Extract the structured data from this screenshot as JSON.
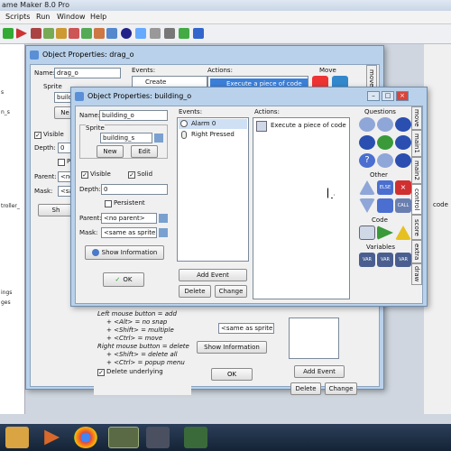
{
  "app": {
    "title": "ame Maker 8.0 Pro",
    "menu": [
      "Scripts",
      "Run",
      "Window",
      "Help"
    ]
  },
  "tree": {
    "items": [
      "s",
      "n_s",
      "",
      "",
      "",
      "",
      "troller_",
      "",
      "",
      "ings",
      "ges"
    ]
  },
  "back_window": {
    "title": "Object Properties: drag_o",
    "name_label": "Name:",
    "name_value": "drag_o",
    "sprite_label": "Sprite",
    "sprite_value": "buildi",
    "new_label": "Ne",
    "visible_label": "Visible",
    "depth_label": "Depth:",
    "depth_value": "0",
    "persistent_label": "P",
    "parent_label": "Parent:",
    "parent_value": "<no",
    "mask_label": "Mask:",
    "mask_value": "<sa",
    "show_label": "Sh",
    "events_label": "Events:",
    "event_create": "Create",
    "actions_label": "Actions:",
    "action_first": "Execute a piece of code",
    "move_label": "Move",
    "move_tab": "move",
    "hint_lines": [
      "Left mouse button = add",
      "+ <Alt> = no snap",
      "+ <Shift> = multiple",
      "+ <Ctrl> = move",
      "Right mouse button = delete",
      "+ <Shift> = delete all",
      "+ <Ctrl> = popup menu"
    ],
    "delete_underlying": "Delete underlying",
    "parent_field_value": "<same as sprite>",
    "show_information": "Show Information",
    "ok_label": "OK",
    "add_event": "Add Event",
    "delete_label": "Delete",
    "change_label": "Change",
    "code_fragment": "code"
  },
  "front_window": {
    "title": "Object Properties: building_o",
    "name_label": "Name:",
    "name_value": "building_o",
    "sprite_label": "Sprite",
    "sprite_value": "building_s",
    "new_label": "New",
    "edit_label": "Edit",
    "visible_label": "Visible",
    "solid_label": "Solid",
    "depth_label": "Depth:",
    "depth_value": "0",
    "persistent_label": "Persistent",
    "parent_label": "Parent:",
    "parent_value": "<no parent>",
    "mask_label": "Mask:",
    "mask_value": "<same as sprite>",
    "show_information": "Show Information",
    "ok_label": "OK",
    "events_label": "Events:",
    "events": [
      "Alarm 0",
      "Right Pressed"
    ],
    "add_event": "Add Event",
    "delete_label": "Delete",
    "change_label": "Change",
    "actions_label": "Actions:",
    "actions": [
      "Execute a piece of code"
    ],
    "questions_label": "Questions",
    "other_label": "Other",
    "code_label": "Code",
    "variables_label": "Variables",
    "tabs": [
      "move",
      "main1",
      "main2",
      "control",
      "score",
      "extra",
      "draw"
    ]
  },
  "taskbar": {
    "items": [
      "folder",
      "media",
      "chrome",
      "gamemaker",
      "app5",
      "app6"
    ]
  }
}
